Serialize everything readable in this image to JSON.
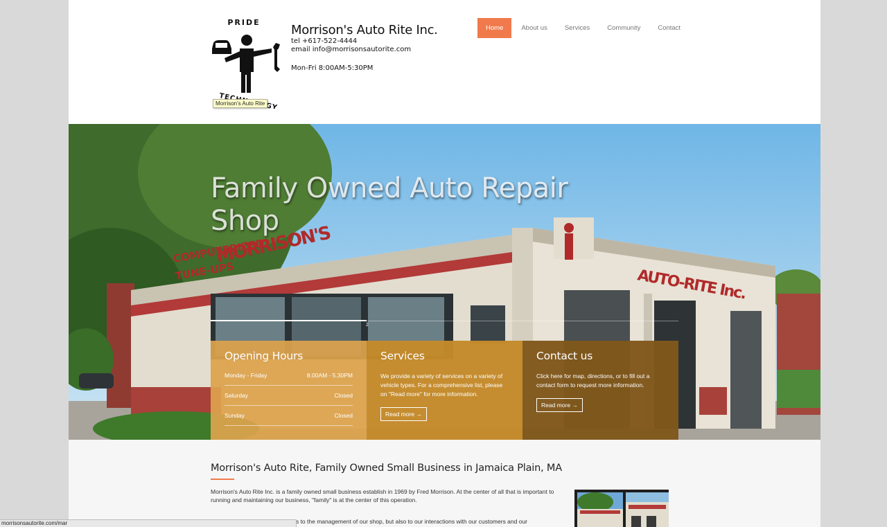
{
  "header": {
    "logo": {
      "text_top": "PRIDE",
      "text_bottom": "TECHNOLOGY",
      "tooltip": "Morrison's Auto Rite"
    },
    "company_name": "Morrison's Auto Rite Inc.",
    "phone": "tel +617-522-4444",
    "email": "email info@morrisonsautorite.com",
    "hours": "Mon-Fri 8:00AM-5:30PM"
  },
  "nav": {
    "items": [
      {
        "label": "Home",
        "active": true
      },
      {
        "label": "About us",
        "active": false
      },
      {
        "label": "Services",
        "active": false
      },
      {
        "label": "Community",
        "active": false
      },
      {
        "label": "Contact",
        "active": false
      }
    ],
    "accent_color": "#f07a4c"
  },
  "hero": {
    "title": "Family Owned Auto Repair Shop",
    "slide_number": "2",
    "building_signs": {
      "main": "MORRISON'S",
      "sub": "AUTO-RITE Inc.",
      "side_top": "COMPUTERIZED",
      "side_bottom": "TUNE-UPS"
    }
  },
  "panels": {
    "hours": {
      "title": "Opening Hours",
      "rows": [
        {
          "day": "Monday - Friday",
          "time": "8.00AM - 5.30PM"
        },
        {
          "day": "Saturday",
          "time": "Closed"
        },
        {
          "day": "Sunday",
          "time": "Closed"
        }
      ],
      "color": "#dda34c"
    },
    "services": {
      "title": "Services",
      "text": "We provide a variety of services on a variety of vehicle types. For a comprehensive list, please on \"Read more\" for more information.",
      "button": "Read more →",
      "color": "#c48a2a"
    },
    "contact": {
      "title": "Contact us",
      "text": "Click here for map, directions, or to fill out a contact form to request more information.",
      "button": "Read more →",
      "color": "#80581c"
    }
  },
  "intro": {
    "heading": "Morrison's Auto Rite, Family Owned Small Business in Jamaica Plain, MA",
    "paragraph1": "Morrison's Auto Rite Inc. is a family owned small business establish in 1969 by Fred Morrison.  At the center of all that is important to running and maintaining our business, \"family\" is at the center of this operation.",
    "paragraph2_fragment": "pplies to the management of our shop, but also to our interactions with our customers and our"
  },
  "status_bar": {
    "url": "morrisonsautorite.com/mar"
  }
}
